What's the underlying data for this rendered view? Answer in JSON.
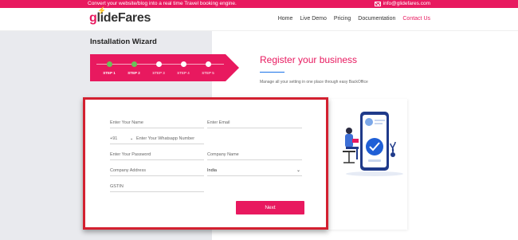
{
  "topbar": {
    "promo": "Convert your website/blog into a real time Travel booking engine.",
    "email": "info@glidefares.com"
  },
  "header": {
    "logo_prefix": "g",
    "logo_text": "lideFares",
    "nav": [
      "Home",
      "Live Demo",
      "Pricing",
      "Documentation",
      "Contact Us"
    ],
    "active_nav": "Contact Us"
  },
  "wizard": {
    "title": "Installation Wizard",
    "steps": [
      {
        "label": "STEP 1",
        "done": true
      },
      {
        "label": "STEP 2",
        "done": true
      },
      {
        "label": "STEP 3",
        "done": false
      },
      {
        "label": "STEP 4",
        "done": false
      },
      {
        "label": "STEP 5",
        "done": false
      }
    ]
  },
  "register": {
    "title": "Register your business",
    "subtitle": "Manage all your setting in one place through easy BackOffice"
  },
  "form": {
    "name_placeholder": "Enter Your Name",
    "email_placeholder": "Enter Email",
    "dial_code": "+91",
    "whatsapp_placeholder": "Enter Your Whatsapp Number",
    "password_placeholder": "Enter Your Password",
    "company_name_placeholder": "Company Name",
    "company_address_placeholder": "Company Address",
    "country_value": "India",
    "gstin_placeholder": "GSTIN",
    "next_label": "Next"
  },
  "colors": {
    "brand": "#e8195f",
    "step_done": "#6ac259",
    "highlight_border": "#d32030"
  }
}
